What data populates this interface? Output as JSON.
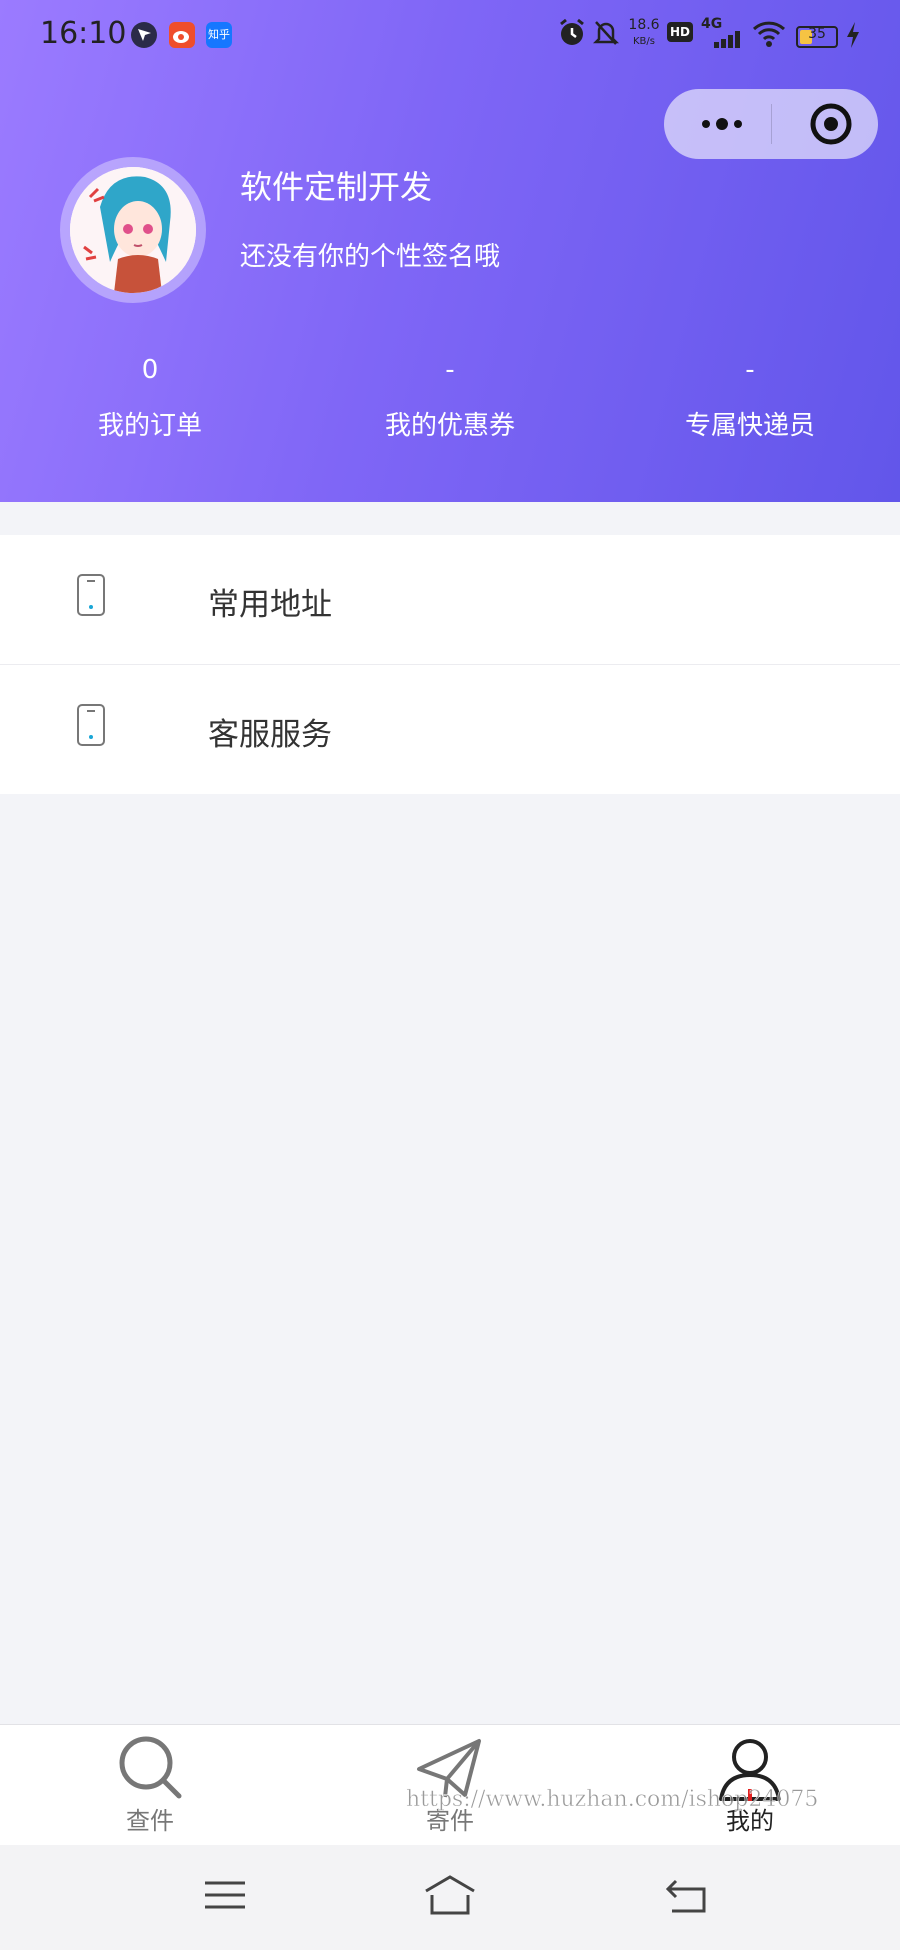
{
  "status_bar": {
    "time": "16:10",
    "apps": [
      "location-arrow-icon",
      "weibo-app-icon",
      "zhihu-app-icon"
    ],
    "zhihu_label": "知乎",
    "net_speed": "18.6",
    "net_unit": "KB/s",
    "hd_label": "HD",
    "network": "4G",
    "battery": "35",
    "battery_level": 0.35
  },
  "capsule": {
    "more_icon": "more-dots-icon",
    "close_icon": "target-circle-icon"
  },
  "profile": {
    "nickname": "软件定制开发",
    "signature": "还没有你的个性签名哦"
  },
  "stats": [
    {
      "value": "0",
      "label": "我的订单"
    },
    {
      "value": "-",
      "label": "我的优惠券"
    },
    {
      "value": "-",
      "label": "专属快递员"
    }
  ],
  "menu": [
    {
      "label": "常用地址",
      "icon": "phone-icon"
    },
    {
      "label": "客服服务",
      "icon": "phone-icon"
    }
  ],
  "tabbar": [
    {
      "label": "查件",
      "icon": "search-icon",
      "active": false
    },
    {
      "label": "寄件",
      "icon": "paper-plane-icon",
      "active": false
    },
    {
      "label": "我的",
      "icon": "user-icon",
      "active": true
    }
  ],
  "watermark": "https://www.huzhan.com/ishop24075",
  "colors": {
    "header_gradient_start": "#9b7bff",
    "header_gradient_end": "#6256ea",
    "page_bg": "#f3f4f8",
    "menu_icon_dot": "#1aa6d6"
  }
}
